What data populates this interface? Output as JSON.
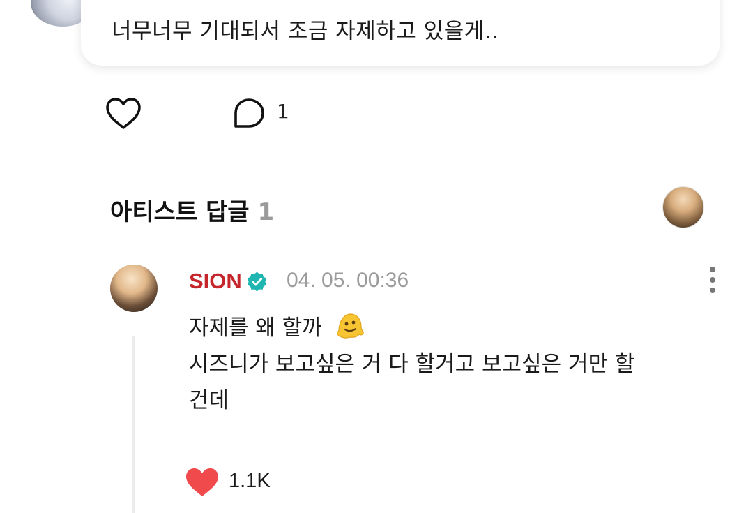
{
  "fan_post": {
    "text": "너무너무 기대되서 조금 자제하고 있을게..",
    "avatar_icon": "user-avatar"
  },
  "actions": {
    "like_icon": "heart-outline-icon",
    "comment_icon": "comment-bubble-icon",
    "comment_count": "1"
  },
  "artist_replies": {
    "title": "아티스트 답글",
    "count": "1",
    "replies": [
      {
        "author": "SION",
        "verified": true,
        "timestamp": "04. 05. 00:36",
        "lines": [
          "자제를 왜 할까",
          "시즈니가 보고싶은 거 다 할거고 보고싶은 거만 할",
          "건데"
        ],
        "emoji": "melting-face-emoji",
        "like_count": "1.1K"
      }
    ]
  },
  "colors": {
    "accent_red": "#c5262c",
    "verified_teal": "#1fb5b0",
    "like_red": "#f04a4d",
    "muted_gray": "#9b9b9b"
  }
}
